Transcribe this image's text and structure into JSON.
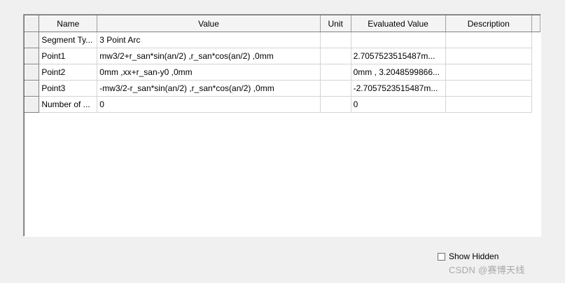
{
  "columns": {
    "name": "Name",
    "value": "Value",
    "unit": "Unit",
    "evaluated": "Evaluated Value",
    "description": "Description"
  },
  "rows": [
    {
      "name": "Segment Ty...",
      "value": "3 Point Arc",
      "unit": "",
      "evaluated": "",
      "description": ""
    },
    {
      "name": "Point1",
      "value": "mw3/2+r_san*sin(an/2) ,r_san*cos(an/2) ,0mm",
      "unit": "",
      "evaluated": "2.7057523515487m...",
      "description": ""
    },
    {
      "name": "Point2",
      "value": "0mm ,xx+r_san-y0 ,0mm",
      "unit": "",
      "evaluated": "0mm , 3.2048599866...",
      "description": ""
    },
    {
      "name": "Point3",
      "value": "-mw3/2-r_san*sin(an/2) ,r_san*cos(an/2) ,0mm",
      "unit": "",
      "evaluated": "-2.7057523515487m...",
      "description": ""
    },
    {
      "name": "Number of ...",
      "value": "0",
      "unit": "",
      "evaluated": "0",
      "description": ""
    }
  ],
  "show_hidden": {
    "label": "Show Hidden",
    "checked": false
  },
  "watermark": "CSDN @赛博天线"
}
